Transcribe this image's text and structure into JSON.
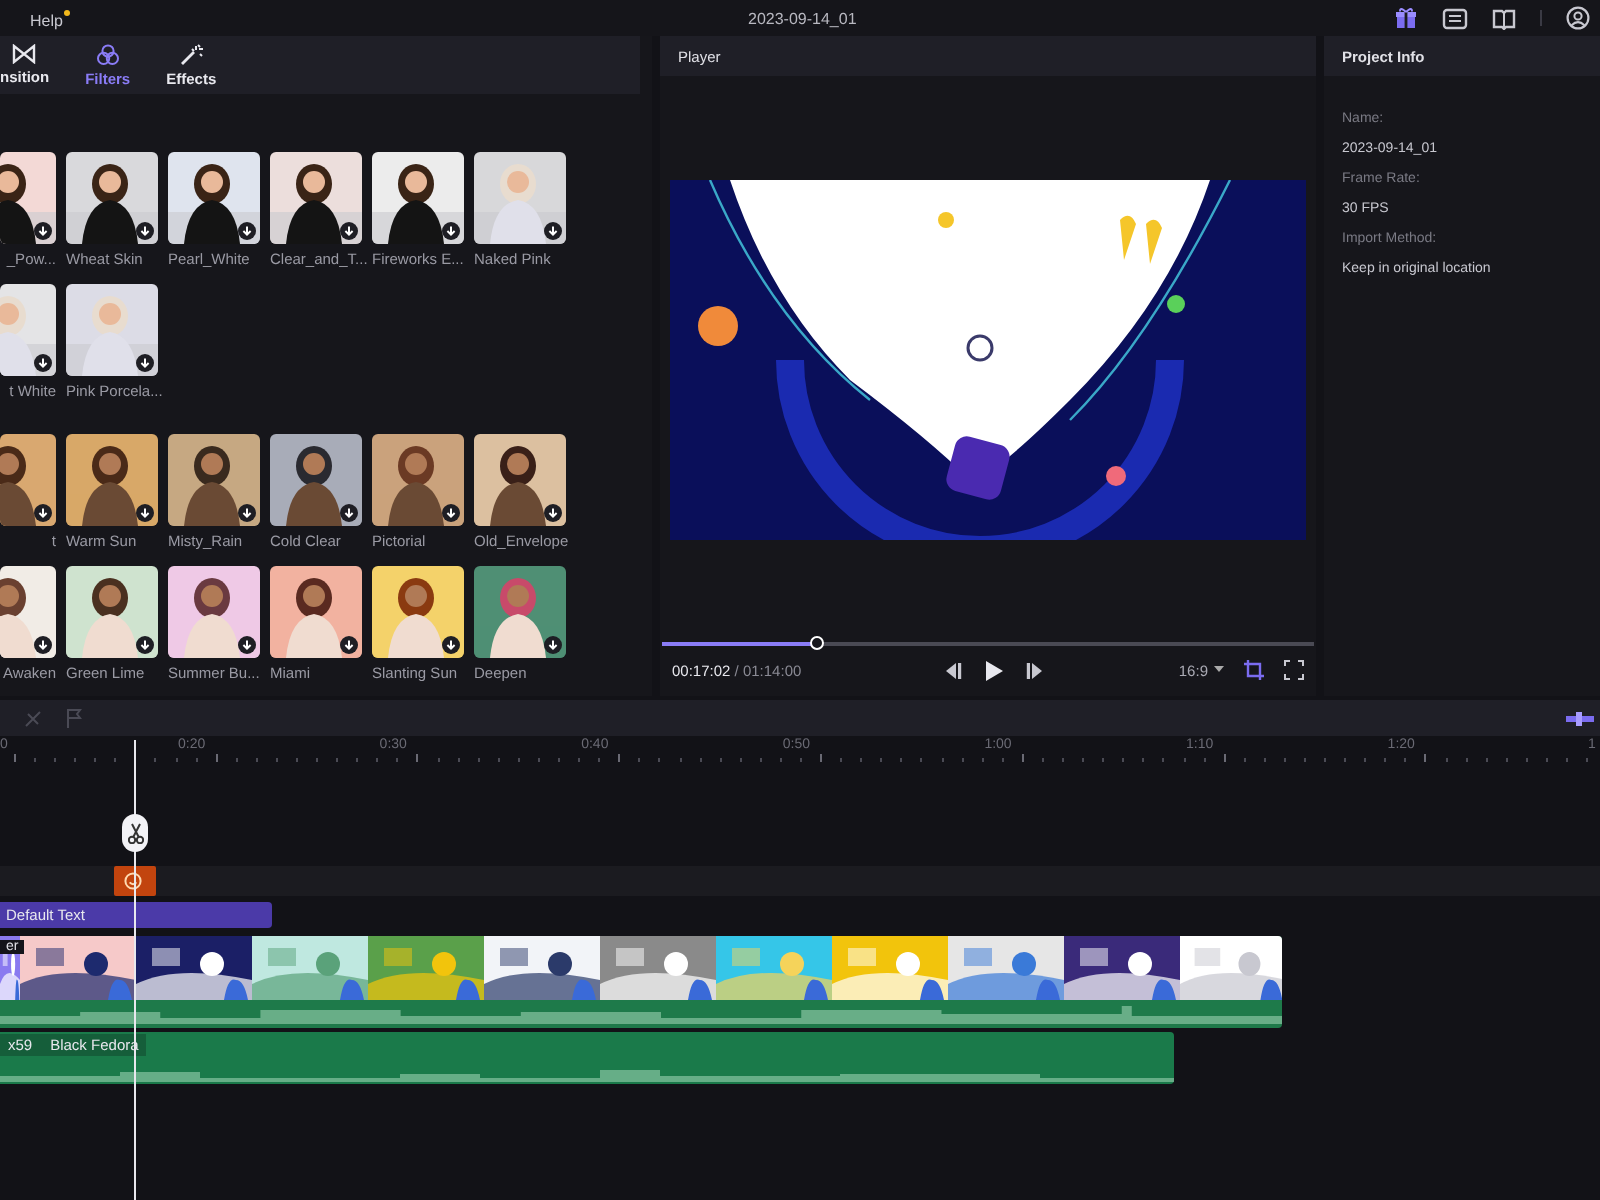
{
  "menu": [
    {
      "label": "Help",
      "notification": true
    }
  ],
  "project_title": "2023-09-14_01",
  "media_tabs": [
    {
      "label": "nsition",
      "selected": false,
      "kind": "transition"
    },
    {
      "label": "Filters",
      "selected": true,
      "kind": "filters"
    },
    {
      "label": "Effects",
      "selected": false,
      "kind": "effects"
    }
  ],
  "filter_groups": [
    {
      "items": [
        {
          "label": "_Pow...",
          "downloaded": false
        },
        {
          "label": "Wheat Skin",
          "downloaded": false
        },
        {
          "label": "Pearl_White",
          "downloaded": false
        },
        {
          "label": "Clear_and_T...",
          "downloaded": false
        },
        {
          "label": "Fireworks E...",
          "downloaded": false
        },
        {
          "label": "Naked Pink",
          "downloaded": false
        },
        {
          "label": "t White",
          "downloaded": false
        },
        {
          "label": "Pink Porcela...",
          "downloaded": false
        }
      ]
    },
    {
      "items": [
        {
          "label": "t",
          "downloaded": false
        },
        {
          "label": "Warm Sun",
          "downloaded": false
        },
        {
          "label": "Misty_Rain",
          "downloaded": false
        },
        {
          "label": "Cold Clear",
          "downloaded": false
        },
        {
          "label": "Pictorial",
          "downloaded": false
        },
        {
          "label": "Old_Envelope",
          "downloaded": false
        },
        {
          "label": "Awaken",
          "downloaded": false
        },
        {
          "label": "Green Lime",
          "downloaded": false
        },
        {
          "label": "Summer Bu...",
          "downloaded": false
        },
        {
          "label": "Miami",
          "downloaded": false
        },
        {
          "label": "Slanting Sun",
          "downloaded": false
        },
        {
          "label": "Deepen",
          "downloaded": false
        }
      ]
    }
  ],
  "player": {
    "title": "Player",
    "level": 0.236,
    "time_current": "00:17:02",
    "time_total": "/ 01:14:00",
    "aspect": "16:9"
  },
  "project_info": {
    "title": "Project Info",
    "fields": [
      {
        "label": "Name:",
        "value": "2023-09-14_01"
      },
      {
        "label": "Frame Rate:",
        "value": "30 FPS"
      },
      {
        "label": "Import Method:",
        "value": "Keep in original location"
      }
    ]
  },
  "timeline": {
    "ruler": [
      "0",
      "0:20",
      "0:30",
      "0:40",
      "0:50",
      "1:00",
      "1:10",
      "1:20",
      "1"
    ],
    "text_clip": "Default Text",
    "video_clip_label": "er",
    "audio_clip_labels": [
      "x59",
      "Black Fedora"
    ]
  }
}
